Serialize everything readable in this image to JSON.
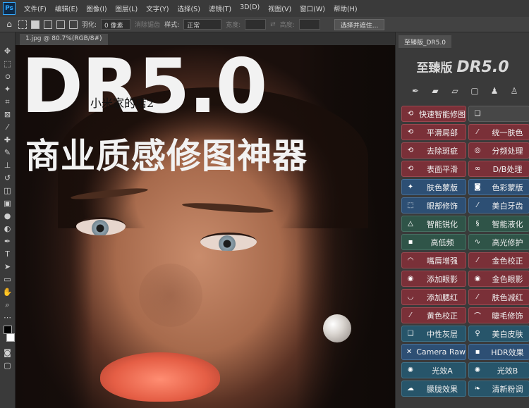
{
  "app": {
    "logo": "Ps"
  },
  "menu": [
    "文件(F)",
    "编辑(E)",
    "图像(I)",
    "图层(L)",
    "文字(Y)",
    "选择(S)",
    "滤镜(T)",
    "3D(D)",
    "视图(V)",
    "窗口(W)",
    "帮助(H)"
  ],
  "options_bar": {
    "feather_label": "羽化:",
    "feather_value": "0 像素",
    "anti_alias_label": "消除锯齿",
    "style_label": "样式:",
    "style_value": "正常",
    "width_label": "宽度:",
    "height_label": "高度:",
    "select_mask_button": "选择并遮住..."
  },
  "document": {
    "tab_title": "1.jpg @ 80.7%(RGB/8#)"
  },
  "canvas_text": {
    "headline": "DR5.0",
    "subline": "商业质感修图神器",
    "watermark": "小米家的店2"
  },
  "panel": {
    "tab_label": "至臻版_DR5.0",
    "title_prefix": "至臻版",
    "title_brand": "DR5.0",
    "icons": [
      "pen-tool-icon",
      "bandage-icon",
      "eraser-icon",
      "rect-icon",
      "person-icon",
      "person-plus-icon"
    ],
    "rows": [
      [
        {
          "label": "快速智能修图",
          "color": "red",
          "icon": "lasso"
        },
        {
          "label": "",
          "color": "gray",
          "icon": "layers"
        }
      ],
      [
        {
          "label": "平滑局部",
          "color": "red",
          "icon": "lasso"
        },
        {
          "label": "统一肤色",
          "color": "red",
          "icon": "brush"
        }
      ],
      [
        {
          "label": "去除斑疵",
          "color": "red",
          "icon": "lasso"
        },
        {
          "label": "分频处理",
          "color": "red",
          "icon": "circle"
        }
      ],
      [
        {
          "label": "表面平滑",
          "color": "red",
          "icon": "lasso"
        },
        {
          "label": "D/B处理",
          "color": "red",
          "icon": "link"
        }
      ],
      [
        {
          "label": "肤色蒙版",
          "color": "blue",
          "icon": "wand"
        },
        {
          "label": "色彩蒙版",
          "color": "blue",
          "icon": "camera"
        }
      ],
      [
        {
          "label": "眼部修饰",
          "color": "blue",
          "icon": "select"
        },
        {
          "label": "美白牙齿",
          "color": "blue",
          "icon": "brush"
        }
      ],
      [
        {
          "label": "智能锐化",
          "color": "green",
          "icon": "triangle"
        },
        {
          "label": "智能液化",
          "color": "green",
          "icon": "swirl"
        }
      ],
      [
        {
          "label": "高低频",
          "color": "green",
          "icon": "square"
        },
        {
          "label": "高光修护",
          "color": "green",
          "icon": "curve"
        }
      ],
      [
        {
          "label": "嘴唇增强",
          "color": "red",
          "icon": "lips"
        },
        {
          "label": "金色校正",
          "color": "red",
          "icon": "dropper"
        }
      ],
      [
        {
          "label": "添加眼影",
          "color": "red",
          "icon": "eye"
        },
        {
          "label": "金色眼影",
          "color": "red",
          "icon": "eye"
        }
      ],
      [
        {
          "label": "添加腮红",
          "color": "red",
          "icon": "blush"
        },
        {
          "label": "肤色减红",
          "color": "red",
          "icon": "dropper"
        }
      ],
      [
        {
          "label": "黄色校正",
          "color": "red",
          "icon": "dropper"
        },
        {
          "label": "睫毛修饰",
          "color": "red",
          "icon": "lash"
        }
      ],
      [
        {
          "label": "中性灰层",
          "color": "teal",
          "icon": "layers"
        },
        {
          "label": "美白皮肤",
          "color": "teal",
          "icon": "bulb"
        }
      ],
      [
        {
          "label": "Camera Raw",
          "color": "blue",
          "icon": "x"
        },
        {
          "label": "HDR效果",
          "color": "blue",
          "icon": "square"
        }
      ],
      [
        {
          "label": "光效A",
          "color": "teal",
          "icon": "star"
        },
        {
          "label": "光效B",
          "color": "teal",
          "icon": "star"
        }
      ],
      [
        {
          "label": "朦胧效果",
          "color": "teal",
          "icon": "cloud"
        },
        {
          "label": "清新粉调",
          "color": "teal",
          "icon": "leaf"
        }
      ]
    ]
  },
  "colors": {
    "red": "#7a3038",
    "blue": "#2d4f74",
    "green": "#2f5448",
    "teal": "#27556a",
    "gray": "#474747"
  }
}
